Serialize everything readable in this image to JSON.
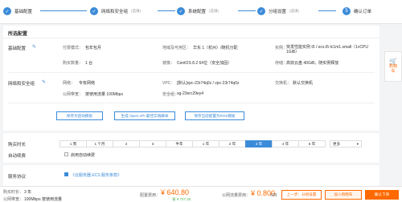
{
  "steps": [
    {
      "num": "✓",
      "label": "基础配置",
      "edit": "(选填)"
    },
    {
      "num": "✓",
      "label": "网络和安全组",
      "edit": "(选填)"
    },
    {
      "num": "✓",
      "label": "系统配置",
      "edit": "(选填)"
    },
    {
      "num": "✓",
      "label": "分组设置",
      "edit": "(选填)"
    },
    {
      "num": "5",
      "label": "确认订单",
      "edit": ""
    }
  ],
  "selected_title": "所选配置",
  "basic": {
    "title": "基础配置",
    "pay_k": "付费模式：",
    "pay_v": "包年包月",
    "region_k": "地域及可用区：",
    "region_v": "华东 1（杭州）/随机分配",
    "inst_k": "实例：",
    "inst_v": "突发性能实例 t5 / ecs.t5-lc1m1.small（1vCPU 1GiB）",
    "qty_k": "购买数量：",
    "qty_v": "1 台",
    "img_k": "镜像：",
    "img_v": "CentOS 8.2 64位（安全加固）",
    "disk_k": "存储：",
    "disk_v": "高效云盘 40GiB，随实例释放"
  },
  "network": {
    "title": "网络和安全组",
    "net_k": "网络：",
    "net_v": "专有网络",
    "vpc_k": "VPC：",
    "vpc_v": "[默认]vpc-23r74q0z / vpc-23r74q0z",
    "sw_k": "交换机：",
    "sw_v": "默认交换机",
    "bw_k": "公网带宽：",
    "bw_v": "按使用流量 100Mbps",
    "sg_k": "安全组：",
    "sg_v": "sg-23erc29ey4"
  },
  "buttons": {
    "save_tpl": "保存为启动模板",
    "gen_api": "生成 Open API 最佳实践脚本",
    "save_ros": "保存当前配置为ROS模板"
  },
  "duration": {
    "label": "购买时长",
    "options": [
      "1 周",
      "1 个月",
      "2",
      "3",
      "半年",
      "1 年",
      "2 年",
      "3 年",
      "4 年",
      "5 年"
    ],
    "selected": "3 年",
    "more": "更多",
    "auto_label": "自动续费",
    "auto_text": "启用自动续费"
  },
  "agreement": {
    "label": "服务协议",
    "text": "《云服务器 ECS 服务条款》"
  },
  "footer": {
    "duration_k": "购买时长：",
    "duration_v": "3 年",
    "bw_k": "公网带宽：",
    "bw_v": "100Mbps 按使用流量",
    "fee_k": "配置费用：",
    "fee_v": "¥ 640.80",
    "save": "省 ¥ 727.20",
    "traffic_k": "公网流量费用：",
    "traffic_v": "¥ 0.800",
    "traffic_unit": "/GB",
    "prev": "上一步：分组设置",
    "cart": "加入购物车",
    "order": "确认下单"
  },
  "side": {
    "text": "购物车"
  }
}
